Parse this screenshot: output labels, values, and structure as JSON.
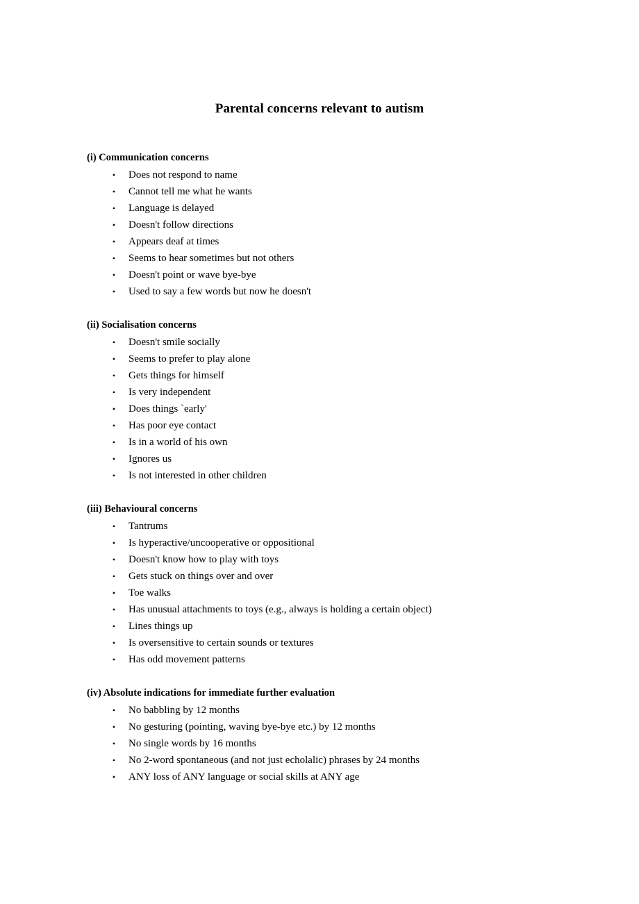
{
  "document": {
    "title": "Parental concerns relevant to autism",
    "bullet_glyph": "•",
    "text_color": "#000000",
    "background_color": "#ffffff",
    "sections": [
      {
        "heading": "(i) Communication concerns",
        "items": [
          "Does not respond to name",
          "Cannot tell me what he wants",
          "Language is delayed",
          "Doesn't follow directions",
          "Appears deaf at times",
          "Seems to hear sometimes but not others",
          "Doesn't point or wave bye-bye",
          "Used to say a few words but now he doesn't"
        ]
      },
      {
        "heading": "(ii) Socialisation concerns",
        "items": [
          "Doesn't smile socially",
          "Seems to prefer to play alone",
          "Gets things for himself",
          "Is very independent",
          "Does things `early'",
          "Has poor eye contact",
          "Is in a world of his own",
          "Ignores us",
          "Is not interested in other children"
        ]
      },
      {
        "heading": "(iii) Behavioural concerns",
        "items": [
          "Tantrums",
          "Is hyperactive/uncooperative or oppositional",
          "Doesn't know how to play with toys",
          "Gets stuck on things over and over",
          "Toe walks",
          "Has unusual attachments to toys (e.g., always is holding a certain object)",
          "Lines things up",
          "Is oversensitive to certain sounds or textures",
          "Has odd movement patterns"
        ]
      },
      {
        "heading": "(iv) Absolute indications for immediate further evaluation",
        "items": [
          "No babbling by 12 months",
          "No gesturing (pointing, waving bye-bye etc.) by 12 months",
          "No single words by 16 months",
          "No 2-word spontaneous (and not just echolalic) phrases by 24 months",
          "ANY loss of ANY language or social skills at ANY age"
        ]
      }
    ]
  }
}
